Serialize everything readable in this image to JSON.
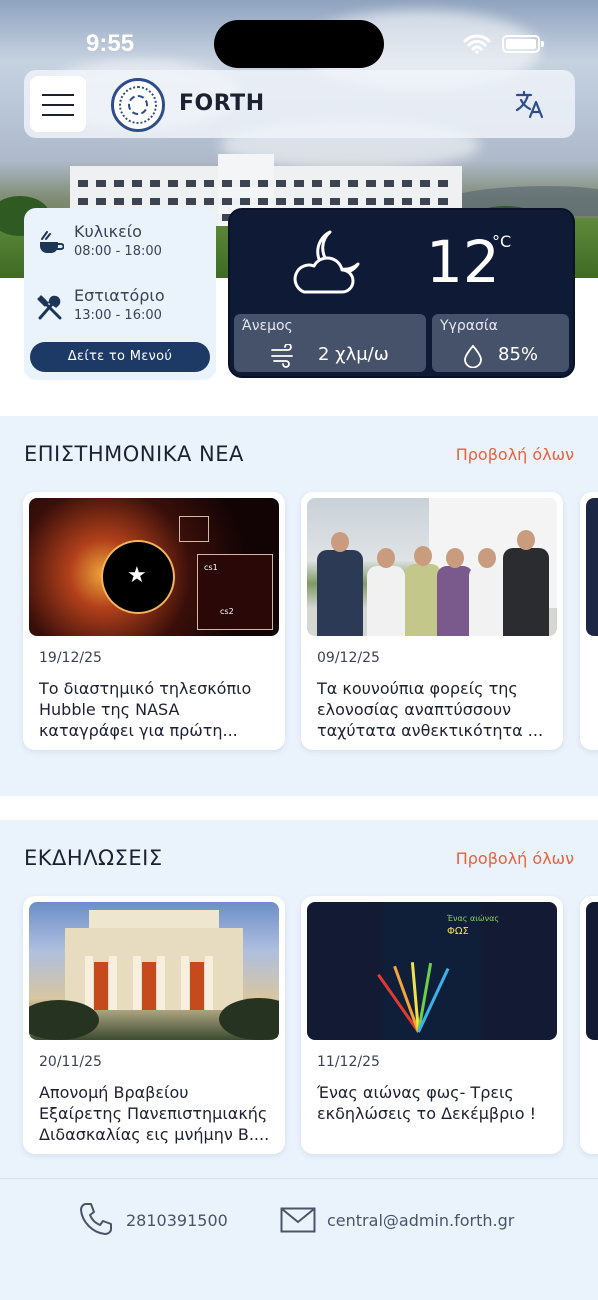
{
  "status_bar": {
    "time": "9:55",
    "icons": [
      "wifi-icon",
      "battery-icon"
    ]
  },
  "header": {
    "brand": "FORTH",
    "menu_icon": "hamburger-icon",
    "logo": "forth-seal-logo",
    "language_icon": "translate-icon"
  },
  "info": {
    "canteen": {
      "title": "Κυλικείο",
      "hours": "08:00 - 18:00",
      "icon": "coffee-icon"
    },
    "restaurant": {
      "title": "Εστιατόριο",
      "hours": "13:00 - 16:00",
      "icon": "utensils-icon"
    },
    "menu_button": "Δείτε το Μενού"
  },
  "weather": {
    "icon": "cloud-moon-icon",
    "temperature": "12",
    "unit": "°C",
    "wind": {
      "label": "Άνεμος",
      "value": "2 χλμ/ω",
      "icon": "wind-icon"
    },
    "humidity": {
      "label": "Υγρασία",
      "value": "85%",
      "icon": "droplet-icon"
    }
  },
  "news": {
    "title": "ΕΠΙΣΤΗΜΟΝΙΚΑ ΝΕΑ",
    "view_all": "Προβολή όλων",
    "items": [
      {
        "date": "19/12/25",
        "title": "Το διαστημικό τηλεσκόπιο Hubble της NASA καταγράφει για πρώτη...",
        "image": "hubble-space-image",
        "inset_labels": [
          "cs1",
          "cs2"
        ]
      },
      {
        "date": "09/12/25",
        "title": "Τα κουνούπια φορείς της ελονοσίας αναπτύσσουν ταχύτατα ανθεκτικότητα ...",
        "image": "research-team-photo"
      }
    ]
  },
  "events": {
    "title": "ΕΚΔΗΛΩΣΕΙΣ",
    "view_all": "Προβολή όλων",
    "items": [
      {
        "date": "20/11/25",
        "title": "Απονομή Βραβείου Εξαίρετης Πανεπιστημιακής Διδασκαλίας εις μνήμην Β....",
        "image": "parliament-building-photo"
      },
      {
        "date": "11/12/25",
        "title": "Ένας αιώνας φως- Τρεις εκδηλώσεις το Δεκέμβριο !",
        "image": "event-poster",
        "poster_text": [
          "Ένας αιώνας",
          "ΦΩΣ"
        ]
      }
    ]
  },
  "footer": {
    "phone": "2810391500",
    "email": "central@admin.forth.gr",
    "phone_icon": "phone-icon",
    "mail_icon": "mail-icon"
  }
}
